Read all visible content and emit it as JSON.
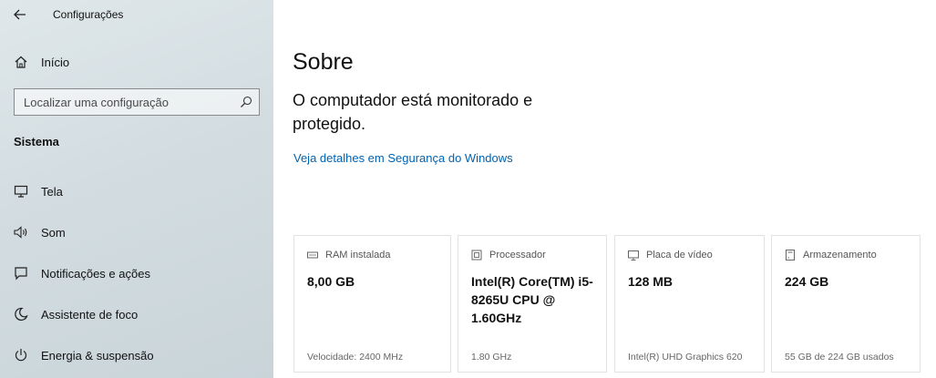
{
  "window": {
    "title": "Configurações"
  },
  "sidebar": {
    "home_label": "Início",
    "search_placeholder": "Localizar uma configuração",
    "section_header": "Sistema",
    "items": [
      {
        "label": "Tela",
        "icon": "monitor-icon"
      },
      {
        "label": "Som",
        "icon": "speaker-icon"
      },
      {
        "label": "Notificações e ações",
        "icon": "notification-icon"
      },
      {
        "label": "Assistente de foco",
        "icon": "moon-icon"
      },
      {
        "label": "Energia & suspensão",
        "icon": "power-icon"
      }
    ]
  },
  "main": {
    "title": "Sobre",
    "status": "O computador está monitorado e protegido.",
    "link": "Veja detalhes em Segurança do Windows",
    "cards": [
      {
        "label": "RAM instalada",
        "value": "8,00 GB",
        "detail": "Velocidade: 2400 MHz",
        "icon": "memory-icon"
      },
      {
        "label": "Processador",
        "value": "Intel(R) Core(TM) i5-8265U CPU @ 1.60GHz",
        "detail": "1.80 GHz",
        "icon": "cpu-icon"
      },
      {
        "label": "Placa de vídeo",
        "value": "128 MB",
        "detail": "Intel(R) UHD Graphics 620",
        "icon": "gpu-icon"
      },
      {
        "label": "Armazenamento",
        "value": "224 GB",
        "detail": "55 GB de 224 GB usados",
        "icon": "storage-icon"
      }
    ]
  },
  "colors": {
    "link": "#0063b1",
    "sidebar_bg": "#d3dde1"
  }
}
